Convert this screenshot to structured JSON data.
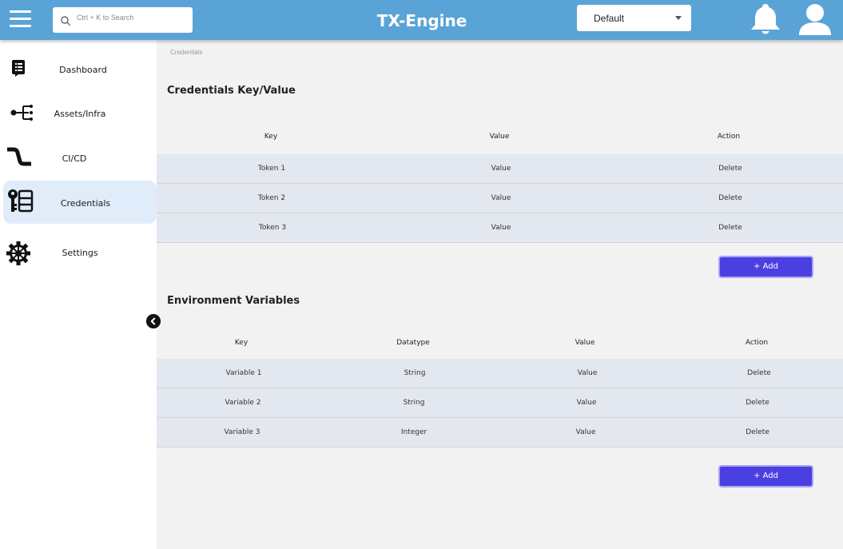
{
  "header": {
    "app_title": "TX-Engine",
    "search_placeholder": "Ctrl + K to Search",
    "environment_select": "Default",
    "brand_color": "#5aa3d6"
  },
  "sidebar": {
    "items": [
      {
        "label": "Dashboard",
        "icon": "document-list-icon"
      },
      {
        "label": "Assets/Infra",
        "icon": "network-tree-icon"
      },
      {
        "label": "CI/CD",
        "icon": "pipeline-icon"
      },
      {
        "label": "Credentials",
        "icon": "key-icon",
        "active": true
      },
      {
        "label": "Settings",
        "icon": "gear-icon"
      }
    ]
  },
  "breadcrumb": "Credentials",
  "credentials": {
    "title": "Credentials Key/Value",
    "headers": [
      "Key",
      "Value",
      "Action"
    ],
    "rows": [
      {
        "key": "Token 1",
        "value": "Value",
        "action": "Delete"
      },
      {
        "key": "Token 2",
        "value": "Value",
        "action": "Delete"
      },
      {
        "key": "Token 3",
        "value": "Value",
        "action": "Delete"
      }
    ],
    "add_label": "+ Add"
  },
  "env_vars": {
    "title": "Environment Variables",
    "headers": [
      "Key",
      "Datatype",
      "Value",
      "Action"
    ],
    "rows": [
      {
        "key": "Variable 1",
        "datatype": "String",
        "value": "Value",
        "action": "Delete"
      },
      {
        "key": "Variable 2",
        "datatype": "String",
        "value": "Value",
        "action": "Delete"
      },
      {
        "key": "Variable 3",
        "datatype": "Integer",
        "value": "Value",
        "action": "Delete"
      }
    ],
    "add_label": "+ Add"
  },
  "colors": {
    "accent": "#4a3fe0",
    "active_nav": "#e1ecfb",
    "row_bg": "#e3e7ef"
  }
}
